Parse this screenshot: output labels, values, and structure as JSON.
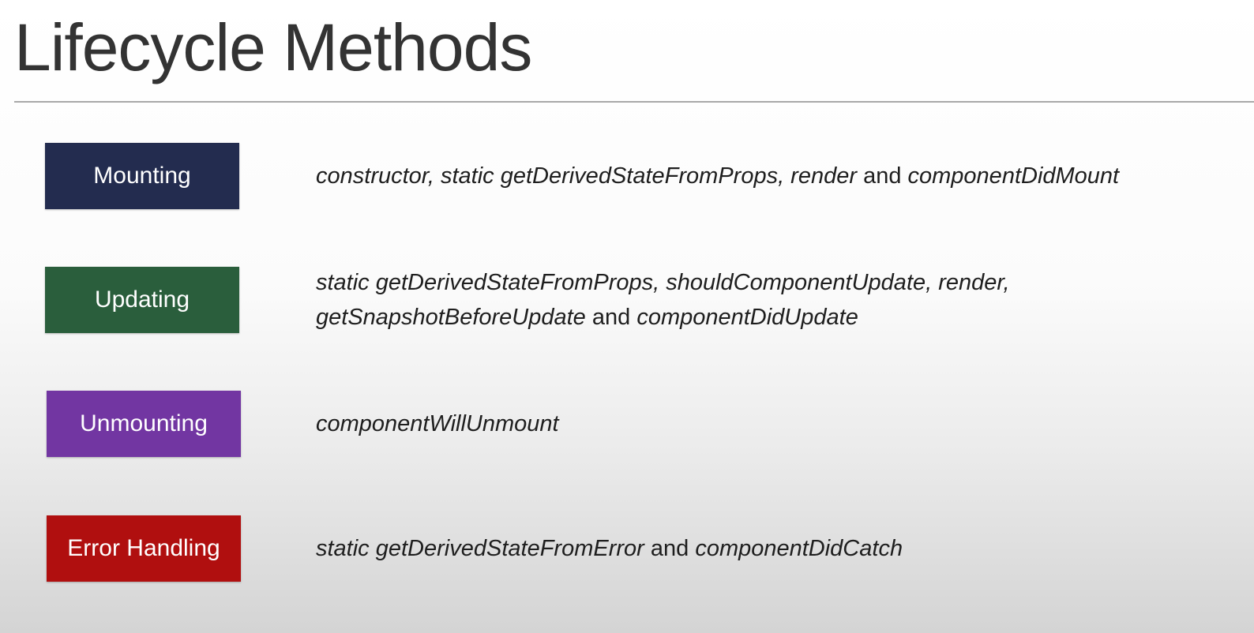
{
  "title": "Lifecycle Methods",
  "phases": [
    {
      "label": "Mounting",
      "color": "#232c4f",
      "lines": [
        [
          {
            "text": "constructor, static getDerivedStateFromProps, render",
            "italic": true
          },
          {
            "text": " and ",
            "italic": false
          },
          {
            "text": "componentDidMount",
            "italic": true
          }
        ]
      ]
    },
    {
      "label": "Updating",
      "color": "#2a5e3c",
      "lines": [
        [
          {
            "text": "static getDerivedStateFromProps, shouldComponentUpdate, render,",
            "italic": true
          }
        ],
        [
          {
            "text": "getSnapshotBeforeUpdate",
            "italic": true
          },
          {
            "text": " and ",
            "italic": false
          },
          {
            "text": "componentDidUpdate",
            "italic": true
          }
        ]
      ]
    },
    {
      "label": "Unmounting",
      "color": "#7236a2",
      "lines": [
        [
          {
            "text": "componentWillUnmount",
            "italic": true
          }
        ]
      ]
    },
    {
      "label": "Error Handling",
      "color": "#b00f0f",
      "lines": [
        [
          {
            "text": "static getDerivedStateFromError",
            "italic": true
          },
          {
            "text": " and ",
            "italic": false
          },
          {
            "text": "componentDidCatch",
            "italic": true
          }
        ]
      ]
    }
  ]
}
